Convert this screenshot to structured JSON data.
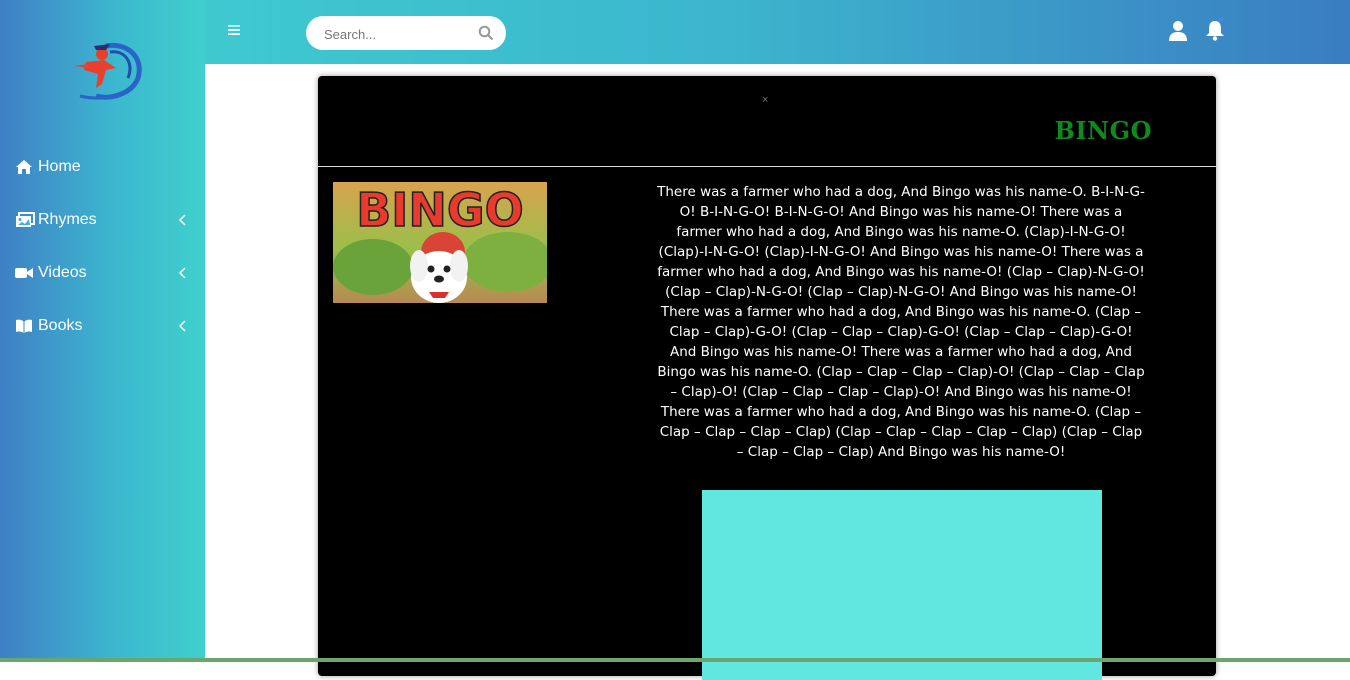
{
  "sidebar": {
    "items": [
      {
        "label": "Home",
        "icon": "home-icon"
      },
      {
        "label": "Rhymes",
        "icon": "images-icon"
      },
      {
        "label": "Videos",
        "icon": "video-icon"
      },
      {
        "label": "Books",
        "icon": "book-icon"
      }
    ]
  },
  "header": {
    "search_placeholder": "Search..."
  },
  "modal": {
    "close": "×",
    "title": "BINGO",
    "thumbnail_text": "BINGO",
    "lyrics": "There was a farmer who had a dog, And Bingo was his name-O. B-I-N-G-O! B-I-N-G-O! B-I-N-G-O! And Bingo was his name-O! There was a farmer who had a dog, And Bingo was his name-O. (Clap)-I-N-G-O! (Clap)-I-N-G-O! (Clap)-I-N-G-O! And Bingo was his name-O! There was a farmer who had a dog, And Bingo was his name-O! (Clap – Clap)-N-G-O! (Clap – Clap)-N-G-O! (Clap – Clap)-N-G-O! And Bingo was his name-O! There was a farmer who had a dog, And Bingo was his name-O. (Clap – Clap – Clap)-G-O! (Clap – Clap – Clap)-G-O! (Clap – Clap – Clap)-G-O! And Bingo was his name-O! There was a farmer who had a dog, And Bingo was his name-O. (Clap – Clap – Clap – Clap)-O! (Clap – Clap – Clap – Clap)-O! (Clap – Clap – Clap – Clap)-O! And Bingo was his name-O! There was a farmer who had a dog, And Bingo was his name-O. (Clap – Clap – Clap – Clap – Clap) (Clap – Clap – Clap – Clap – Clap) (Clap – Clap – Clap – Clap – Clap) And Bingo was his name-O!"
  },
  "colors": {
    "title_green": "#0f8a1c",
    "video_placeholder": "#62e6e0"
  }
}
